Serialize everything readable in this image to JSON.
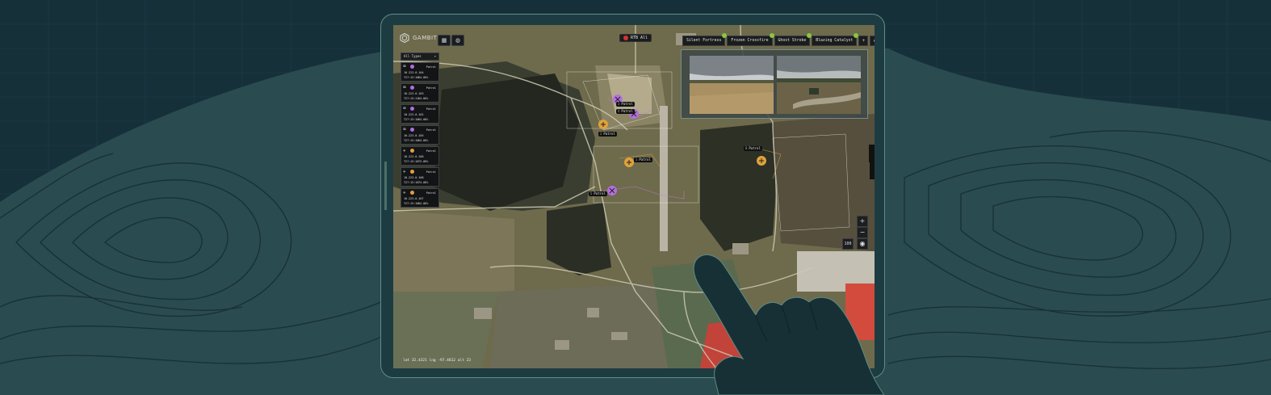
{
  "app": {
    "name": "GAMBIT"
  },
  "toolbar": {
    "rtb_label": "RTB All"
  },
  "mission_tabs": [
    {
      "label": "Silent Fortress"
    },
    {
      "label": "Frozen Crossfire"
    },
    {
      "label": "Ghost Stroke"
    },
    {
      "label": "Blazing Catalyst"
    }
  ],
  "filter": {
    "label": "All Types",
    "chevron": "▾"
  },
  "assets": [
    {
      "type_icon": "quadcopter-icon",
      "badge_color": "#b56bdc",
      "role": "Patrol",
      "ip": "10.223.0.104",
      "time": "T27:15:10",
      "battery": "64.00%"
    },
    {
      "type_icon": "quadcopter-icon",
      "badge_color": "#b56bdc",
      "role": "Patrol",
      "ip": "10.223.0.103",
      "time": "T27:15:11",
      "battery": "64.00%"
    },
    {
      "type_icon": "quadcopter-icon",
      "badge_color": "#b56bdc",
      "role": "Patrol",
      "ip": "10.223.0.102",
      "time": "T27:15:10",
      "battery": "64.00%"
    },
    {
      "type_icon": "quadcopter-icon",
      "badge_color": "#b56bdc",
      "role": "Patrol",
      "ip": "10.223.0.105",
      "time": "T27:15:10",
      "battery": "64.00%"
    },
    {
      "type_icon": "fixed-wing-icon",
      "badge_color": "#e2a040",
      "role": "Patrol",
      "ip": "10.223.0.106",
      "time": "T27:15:10",
      "battery": "73.00%"
    },
    {
      "type_icon": "fixed-wing-icon",
      "badge_color": "#e2a040",
      "role": "Patrol",
      "ip": "10.223.0.108",
      "time": "T27:15:10",
      "battery": "74.00%"
    },
    {
      "type_icon": "fixed-wing-icon",
      "badge_color": "#e2a040",
      "role": "Patrol",
      "ip": "10.223.0.107",
      "time": "T27:15:10",
      "battery": "64.00%"
    }
  ],
  "map_labels": [
    {
      "n": "3",
      "text": "Patrol"
    },
    {
      "n": "2",
      "text": "Patrol"
    },
    {
      "n": "1",
      "text": "Patrol"
    },
    {
      "n": "5",
      "text": "Patrol"
    },
    {
      "n": "8",
      "text": "Patrol"
    },
    {
      "n": "4",
      "text": "Patrol"
    }
  ],
  "map_controls": {
    "zoom_in": "+",
    "zoom_out": "−",
    "scale": "100"
  },
  "coords": "lat 32.4321  lng -97.4812  alt 23",
  "colors": {
    "quad_badge": "#b56bdc",
    "wing_badge": "#e2a040",
    "status_ok": "#8cc63f",
    "rtb": "#d43434",
    "accent": "#5f8e86"
  }
}
